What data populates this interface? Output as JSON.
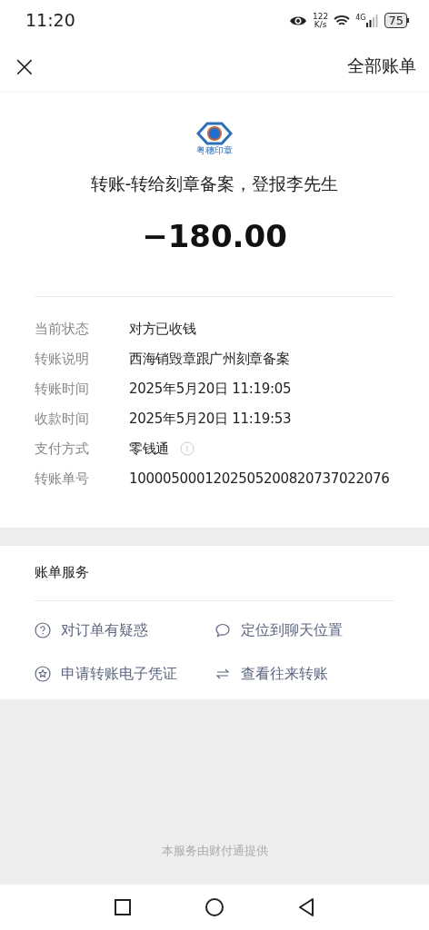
{
  "status_bar": {
    "time": "11:20",
    "speed": "122",
    "speed_unit": "K/s",
    "network": "4G",
    "battery": "75"
  },
  "header": {
    "close": "×",
    "title": "全部账单"
  },
  "payee": {
    "logo_text": "粤穗印章",
    "title": "转账-转给刻章备案，登报李先生",
    "amount": "−180.00"
  },
  "details": [
    {
      "label": "当前状态",
      "value": "对方已收钱"
    },
    {
      "label": "转账说明",
      "value": "西海销毁章跟广州刻章备案"
    },
    {
      "label": "转账时间",
      "value": "2025年5月20日 11:19:05"
    },
    {
      "label": "收款时间",
      "value": "2025年5月20日 11:19:53"
    },
    {
      "label": "支付方式",
      "value": "零钱通",
      "info": true
    },
    {
      "label": "转账单号",
      "value": "1000050001202505200820737022076"
    }
  ],
  "services": {
    "title": "账单服务",
    "items": [
      {
        "kind": "question",
        "label": "对订单有疑惑"
      },
      {
        "kind": "chat",
        "label": "定位到聊天位置"
      },
      {
        "kind": "certificate",
        "label": "申请转账电子凭证"
      },
      {
        "kind": "swap",
        "label": "查看往来转账"
      }
    ]
  },
  "footer": "本服务由财付通提供"
}
